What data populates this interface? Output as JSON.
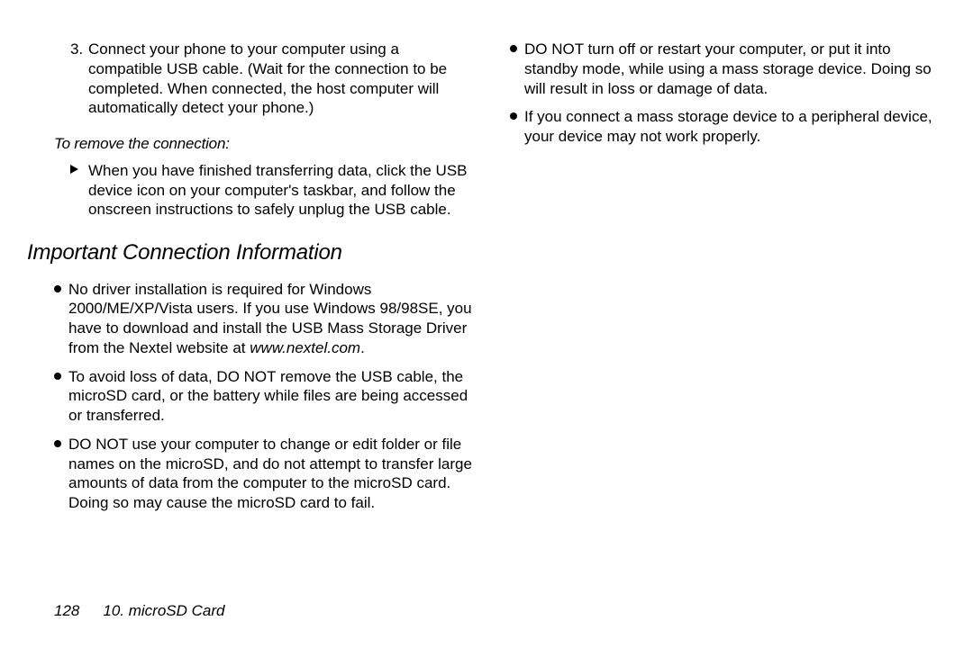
{
  "left": {
    "step": {
      "number": "3.",
      "text": "Connect your phone to your computer using a compatible USB cable. (Wait for the connection to be completed. When connected, the host computer will automatically detect your phone.)"
    },
    "remove_heading": "To remove the connection:",
    "remove_item": "When you have finished transferring data, click the USB device icon on your computer's taskbar, and follow the onscreen instructions to safely unplug the USB cable.",
    "section_title": "Important Connection Information",
    "info_item_1_pre": "No driver installation is required for Windows 2000/ME/XP/Vista users. If you use Windows 98/98SE, you have to download and install the USB Mass Storage Driver from the Nextel website at ",
    "info_item_1_link": "www.nextel.com",
    "info_item_1_post": ".",
    "info_item_2": "To avoid loss of data, DO NOT remove the USB cable, the microSD card, or the battery while files are being accessed or transferred.",
    "info_item_3": "DO NOT use your computer to change or edit folder or file names on the microSD, and do not attempt to transfer large amounts of data from the computer to the microSD card. Doing so may cause the microSD card to fail."
  },
  "right": {
    "info_item_4": "DO NOT turn off or restart your computer, or put it into standby mode, while using a mass storage device. Doing so will result in loss or damage of data.",
    "info_item_5": "If you connect a mass storage device to a peripheral device, your device may not work properly."
  },
  "footer": {
    "page_number": "128",
    "chapter": "10. microSD Card"
  }
}
